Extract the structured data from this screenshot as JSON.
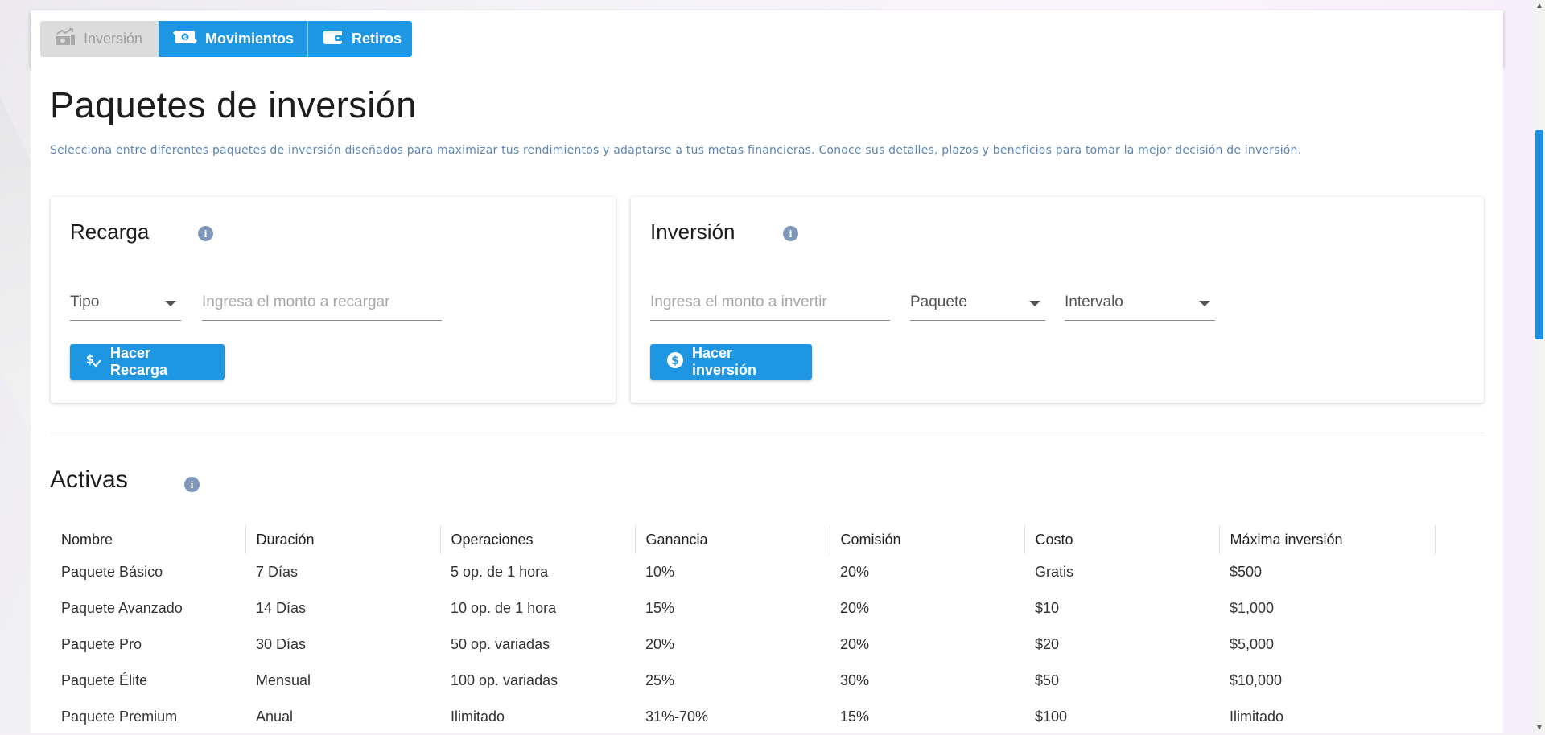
{
  "tabs": [
    {
      "label": "Inversión",
      "icon": "chart-growth-icon",
      "disabled": true
    },
    {
      "label": "Movimientos",
      "icon": "money-exchange-icon",
      "disabled": false
    },
    {
      "label": "Retiros",
      "icon": "wallet-icon",
      "disabled": false
    }
  ],
  "page": {
    "title": "Paquetes de inversión",
    "subtitle": "Selecciona entre diferentes paquetes de inversión diseñados para maximizar tus rendimientos y adaptarse a tus metas financieras. Conoce sus detalles, plazos y beneficios para tomar la mejor decisión de inversión."
  },
  "recarga": {
    "title": "Recarga",
    "tipo_label": "Tipo",
    "monto_placeholder": "Ingresa el monto a recargar",
    "button_label": "Hacer Recarga"
  },
  "inversion": {
    "title": "Inversión",
    "monto_placeholder": "Ingresa el monto a invertir",
    "paquete_label": "Paquete",
    "intervalo_label": "Intervalo",
    "button_label": "Hacer inversión"
  },
  "activas": {
    "title": "Activas",
    "columns": [
      "Nombre",
      "Duración",
      "Operaciones",
      "Ganancia",
      "Comisión",
      "Costo",
      "Máxima inversión"
    ],
    "rows": [
      [
        "Paquete Básico",
        "7 Días",
        "5 op. de 1 hora",
        "10%",
        "20%",
        "Gratis",
        "$500"
      ],
      [
        "Paquete Avanzado",
        "14 Días",
        "10 op. de 1 hora",
        "15%",
        "20%",
        "$10",
        "$1,000"
      ],
      [
        "Paquete Pro",
        "30 Días",
        "50 op. variadas",
        "20%",
        "20%",
        "$20",
        "$5,000"
      ],
      [
        "Paquete Élite",
        "Mensual",
        "100 op. variadas",
        "25%",
        "30%",
        "$50",
        "$10,000"
      ],
      [
        "Paquete Premium",
        "Anual",
        "Ilimitado",
        "31%-70%",
        "15%",
        "$100",
        "Ilimitado"
      ]
    ]
  },
  "colors": {
    "accent": "#1e96e2",
    "disabled_tab": "#dcdcdc",
    "subtitle": "#5b86b5",
    "info_icon": "#7f97b8"
  }
}
